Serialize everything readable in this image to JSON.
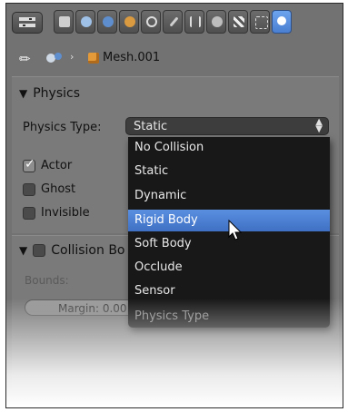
{
  "context": {
    "object_name": "Mesh.001"
  },
  "physics_panel": {
    "title": "Physics",
    "physics_type_label": "Physics Type:",
    "physics_type_value": "Static",
    "checkboxes": [
      {
        "label": "Actor",
        "checked": true
      },
      {
        "label": "Ghost",
        "checked": false
      },
      {
        "label": "Invisible",
        "checked": false
      }
    ]
  },
  "collision_panel": {
    "title": "Collision Bo",
    "bounds_label": "Bounds:",
    "margin_label": "Margin: 0.00"
  },
  "dropdown": {
    "items": [
      "No Collision",
      "Static",
      "Dynamic",
      "Rigid Body",
      "Soft Body",
      "Occlude",
      "Sensor"
    ],
    "selected_index": 3,
    "footer": "Physics Type"
  },
  "colors": {
    "accent": "#4f82d6",
    "panel_bg": "#7a7a7a",
    "menu_bg": "#181818"
  }
}
